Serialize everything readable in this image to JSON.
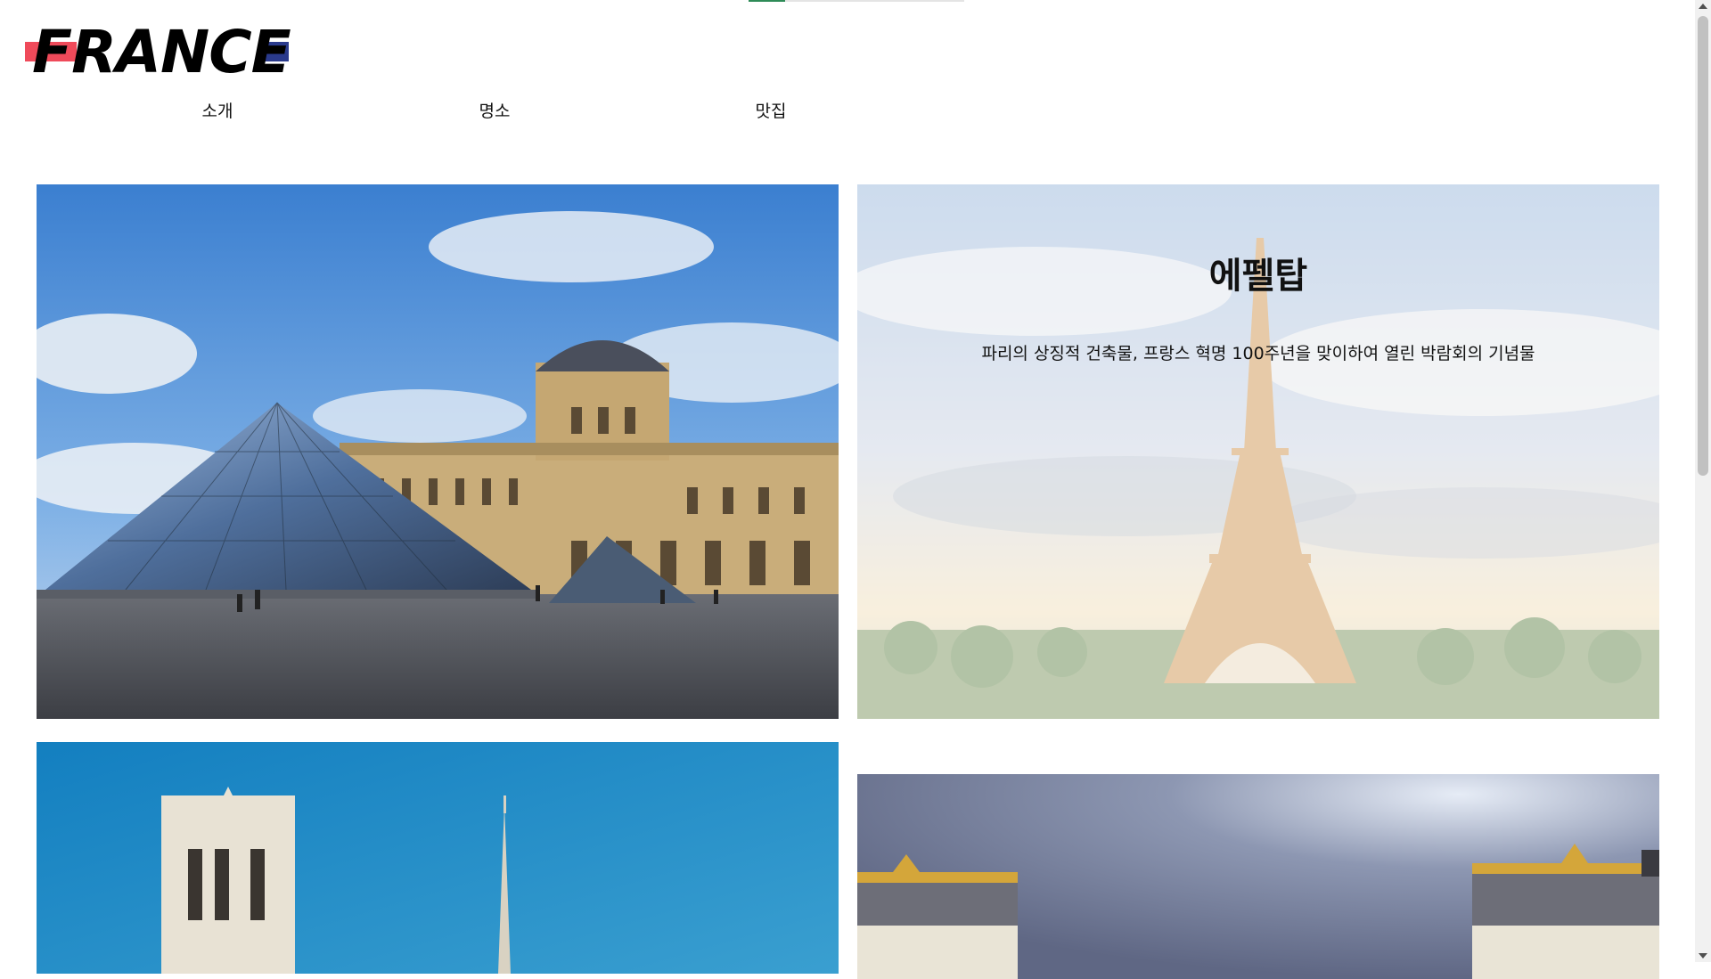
{
  "header": {
    "logo_text": "FRANCE",
    "logo_colors": {
      "red": "#ef4a5a",
      "blue": "#2a3a8c"
    },
    "progress": 0.17
  },
  "nav": {
    "items": [
      {
        "label": "소개"
      },
      {
        "label": "명소"
      },
      {
        "label": "맛집"
      }
    ]
  },
  "gallery": {
    "cards": [
      {
        "image": "louvre-pyramid-photo"
      },
      {
        "image": "eiffel-tower-photo",
        "title": "에펠탑",
        "description": "파리의 상징적 건축물, 프랑스 혁명 100주년을 맞이하여 열린 박람회의 기념물"
      },
      {
        "image": "notre-dame-photo"
      },
      {
        "image": "versailles-palace-photo"
      }
    ]
  },
  "scrollbar": {
    "position": 0.0
  }
}
